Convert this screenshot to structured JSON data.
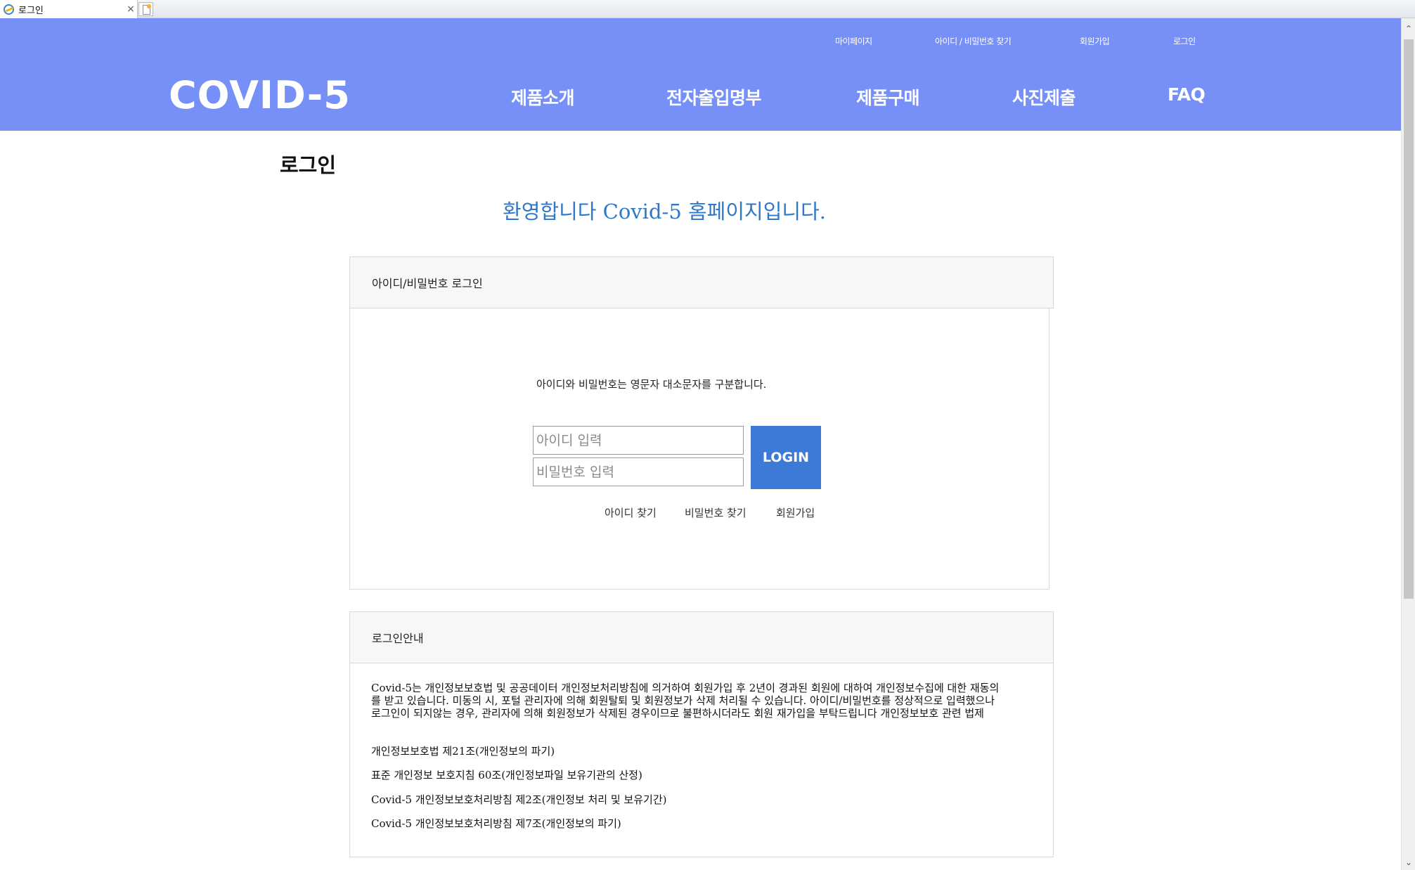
{
  "browser": {
    "tab_title": "로그인",
    "close_glyph": "×"
  },
  "header": {
    "logo": "COVID-5",
    "util_nav": [
      "마이페이지",
      "아이디 / 비밀번호 찾기",
      "회원가입",
      "로그인"
    ],
    "main_nav": [
      "제품소개",
      "전자출입명부",
      "제품구매",
      "사진제출",
      "FAQ"
    ],
    "background_color": "#7790f8"
  },
  "page": {
    "title": "로그인",
    "welcome": "환영합니다 Covid-5 홈페이지입니다."
  },
  "login_panel": {
    "heading": "아이디/비밀번호 로그인",
    "notice": "아이디와 비밀번호는 영문자 대소문자를 구분합니다.",
    "id_placeholder": "아이디 입력",
    "pw_placeholder": "비밀번호 입력",
    "login_button": "LOGIN",
    "links": [
      "아이디 찾기",
      "비밀번호 찾기",
      "회원가입"
    ],
    "button_color": "#3d7ad7"
  },
  "guide_panel": {
    "heading": "로그인안내",
    "paragraph": "Covid-5는 개인정보보호법 및 공공데이터 개인정보처리방침에 의거하여 회원가입 후 2년이 경과된 회원에 대하여 개인정보수집에 대한 재동의를 받고 있습니다. 미동의 시, 포털 관리자에 의해 회원탈퇴 및 회원정보가 삭제 처리될 수 있습니다. 아이디/비밀번호를 정상적으로 입력했으나 로그인이 되지않는 경우, 관리자에 의해 회원정보가 삭제된 경우이므로 불편하시더라도 회원 재가입을 부탁드립니다 개인정보보호 관련 법제",
    "laws": [
      "개인정보보호법 제21조(개인정보의 파기)",
      "표준 개인정보 보호지침 60조(개인정보파일 보유기관의 산정)",
      "Covid-5 개인정보보호처리방침 제2조(개인정보 처리 및 보유기간)",
      "Covid-5 개인정보보호처리방침 제7조(개인정보의 파기)"
    ]
  },
  "scrollbar": {
    "up_glyph": "⌃",
    "down_glyph": "⌄"
  }
}
